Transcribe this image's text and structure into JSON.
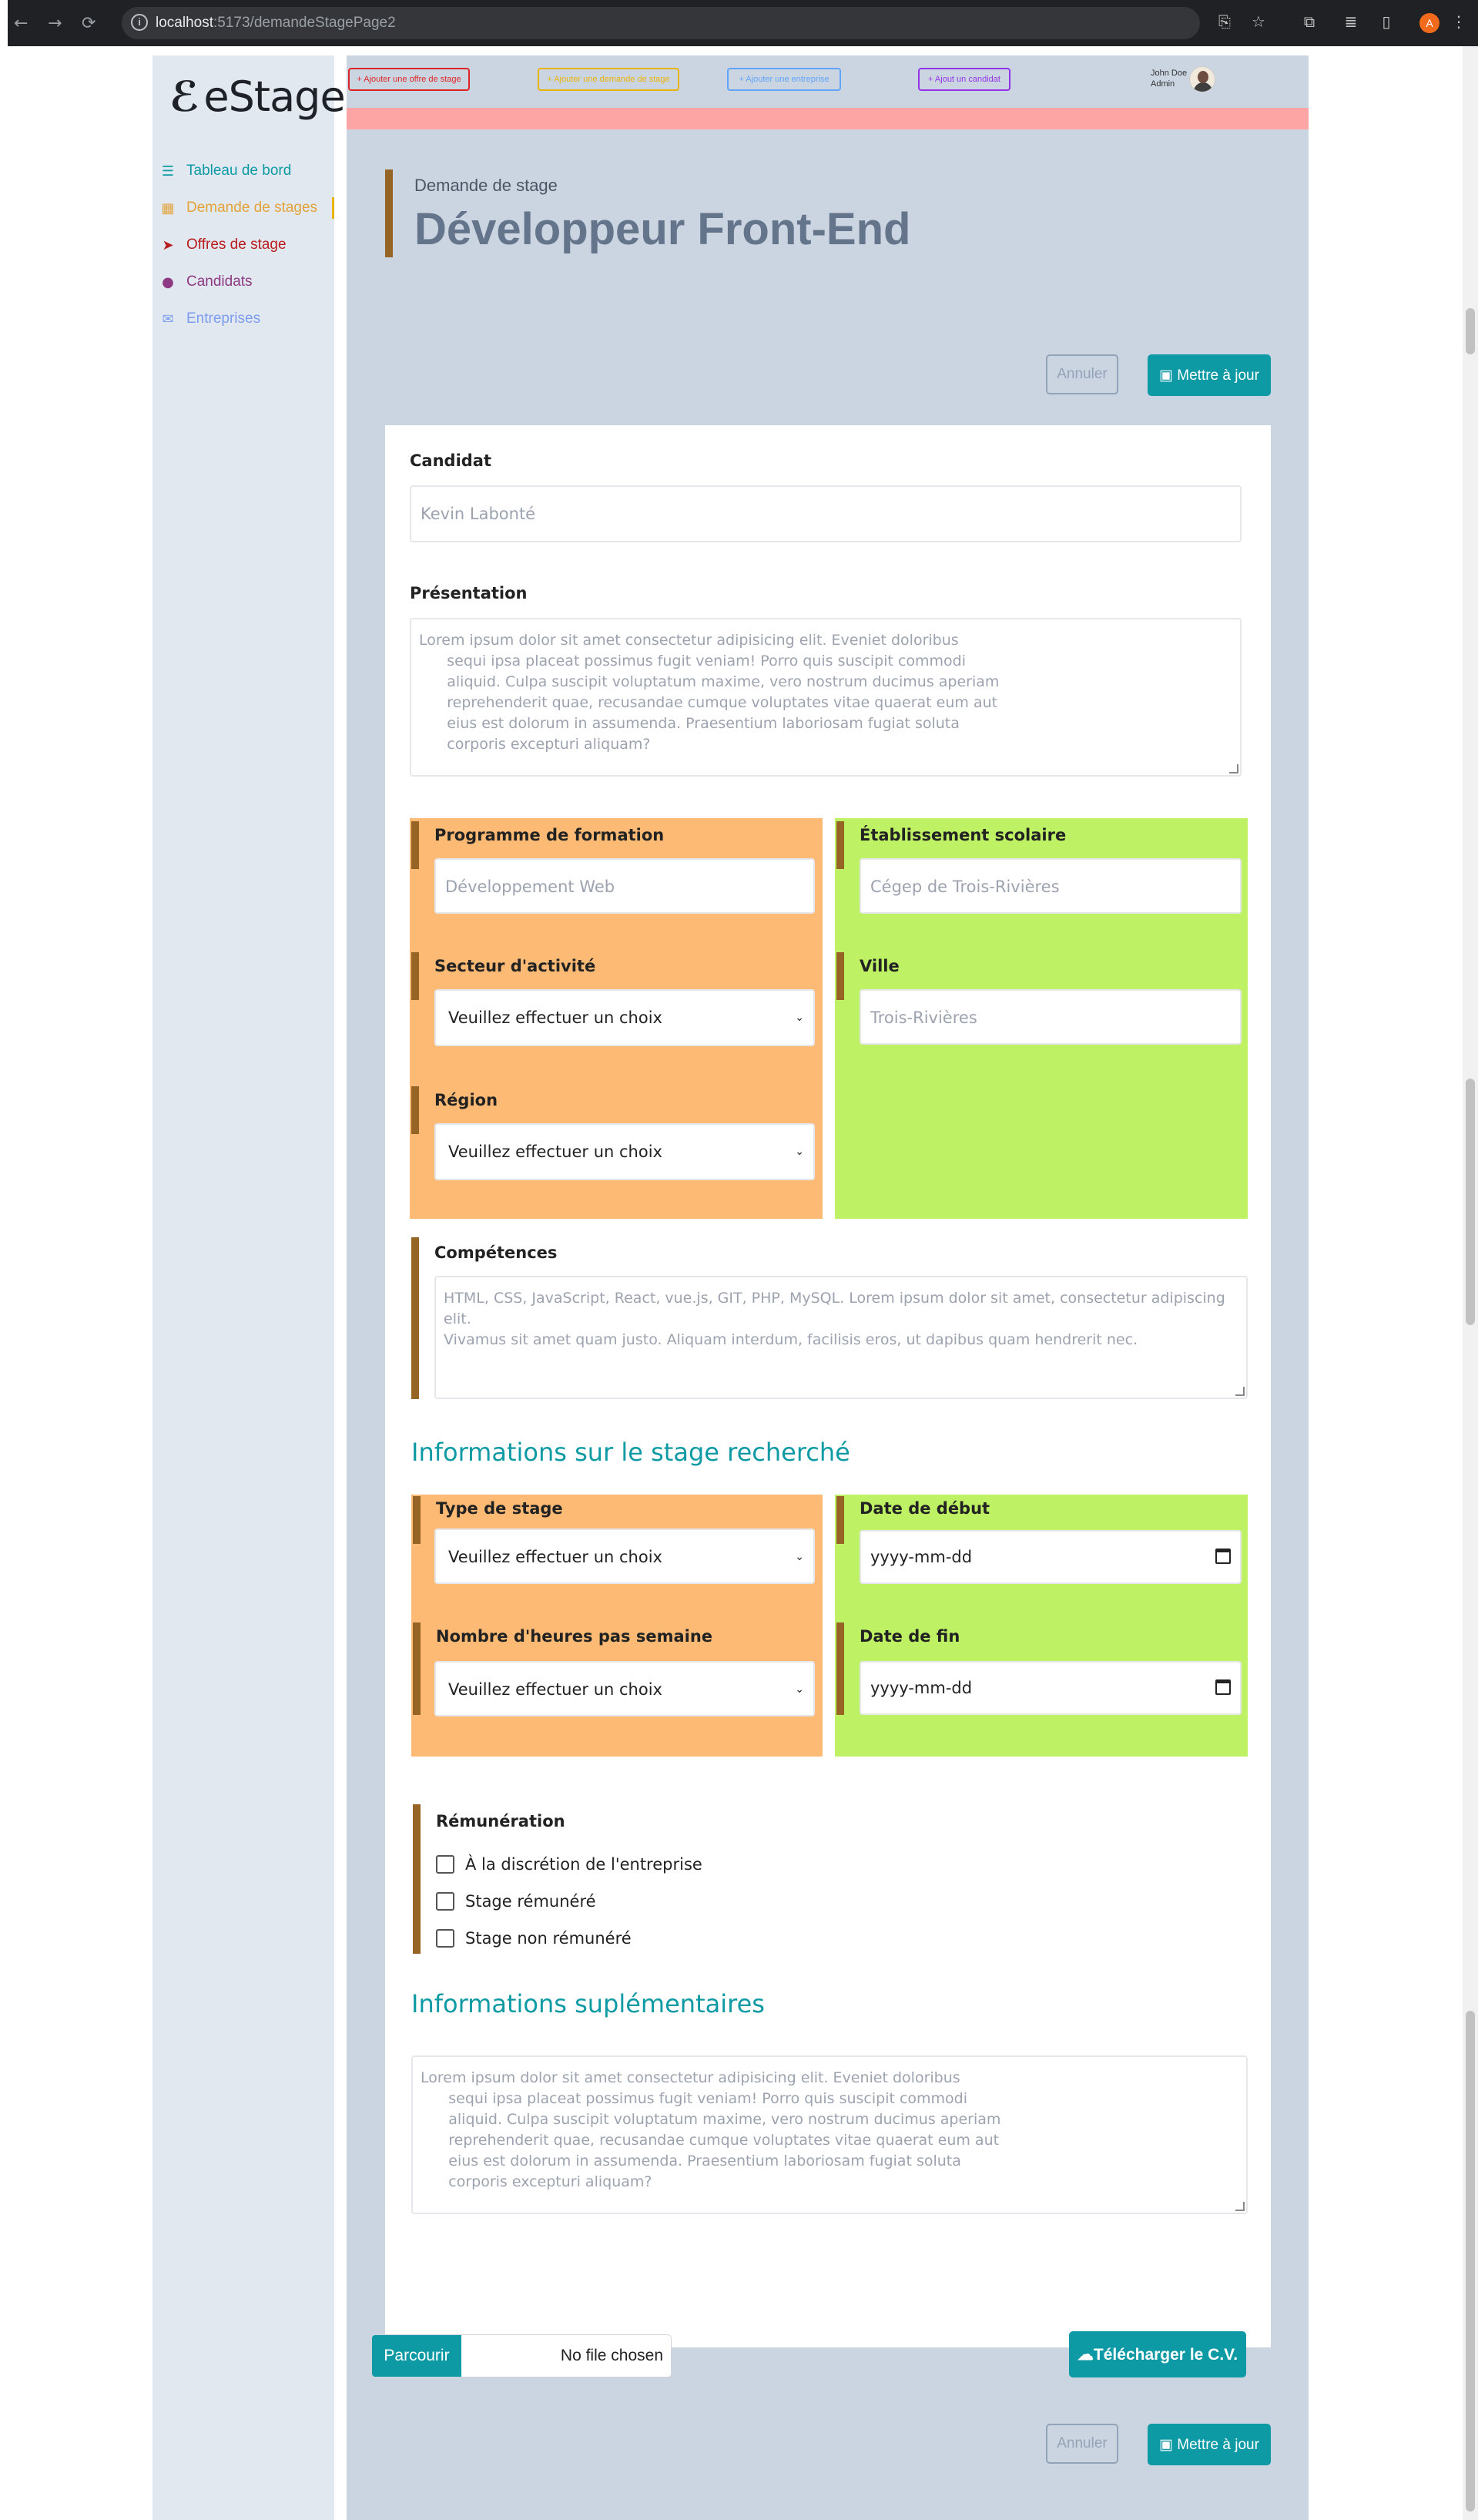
{
  "browser": {
    "url_host": "localhost",
    "url_rest": ":5173/demandeStagePage2",
    "profile_initial": "A"
  },
  "sidebar": {
    "logo": "eStage",
    "items": [
      {
        "label": "Tableau de bord",
        "icon": "list-icon",
        "color": "#0e9aa4"
      },
      {
        "label": "Demande de stages",
        "icon": "calendar-icon",
        "color": "#e3a33a"
      },
      {
        "label": "Offres de stage",
        "icon": "send-icon",
        "color": "#b91c1c"
      },
      {
        "label": "Candidats",
        "icon": "user-icon",
        "color": "#8e3a82"
      },
      {
        "label": "Entreprises",
        "icon": "mail-icon",
        "color": "#7b9cf0"
      }
    ]
  },
  "topbar": {
    "quick_actions": [
      {
        "label": "+ Ajouter une offre de stage",
        "color": "#dc2626"
      },
      {
        "label": "+ Ajouter une demande de stage",
        "color": "#eab308"
      },
      {
        "label": "+ Ajouter une entreprise",
        "color": "#60a5fa"
      },
      {
        "label": "+ Ajout un candidat",
        "color": "#9333ea"
      }
    ],
    "user_name": "John Doe",
    "user_role": "Admin"
  },
  "header": {
    "subtitle": "Demande de stage",
    "title": "Développeur Front-End"
  },
  "actions": {
    "cancel": "Annuler",
    "update": "Mettre à jour"
  },
  "form": {
    "candidat_label": "Candidat",
    "candidat_placeholder": "Kevin Labonté",
    "presentation_label": "Présentation",
    "presentation_text": "Lorem ipsum dolor sit amet consectetur adipisicing elit. Eveniet doloribus\n      sequi ipsa placeat possimus fugit veniam! Porro quis suscipit commodi\n      aliquid. Culpa suscipit voluptatum maxime, vero nostrum ducimus aperiam\n      reprehenderit quae, recusandae cumque voluptates vitae quaerat eum aut\n      eius est dolorum in assumenda. Praesentium laboriosam fugiat soluta\n      corporis excepturi aliquam?",
    "programme_label": "Programme de formation",
    "programme_placeholder": "Développement Web",
    "etablissement_label": "Établissement scolaire",
    "etablissement_placeholder": "Cégep de Trois-Rivières",
    "secteur_label": "Secteur d'activité",
    "secteur_value": "Veuillez effectuer un choix",
    "ville_label": "Ville",
    "ville_placeholder": "Trois-Rivières",
    "region_label": "Région",
    "region_value": "Veuillez effectuer un choix",
    "competences_label": "Compétences",
    "competences_text": "HTML, CSS, JavaScript, React, vue.js, GIT, PHP, MySQL. Lorem ipsum dolor sit amet, consectetur adipiscing elit.\nVivamus sit amet quam justo. Aliquam interdum, facilisis eros, ut dapibus quam hendrerit nec.",
    "stage_section_title": "Informations sur le stage recherché",
    "type_label": "Type de stage",
    "type_value": "Veuillez effectuer un choix",
    "date_debut_label": "Date de début",
    "date_debut_value": "yyyy-mm-dd",
    "heures_label": "Nombre d'heures pas semaine",
    "heures_value": "Veuillez effectuer un choix",
    "date_fin_label": "Date de fin",
    "date_fin_value": "yyyy-mm-dd",
    "remuneration_label": "Rémunération",
    "remuneration_options": [
      "À la discrétion de l'entreprise",
      "Stage rémunéré",
      "Stage non rémunéré"
    ],
    "supp_section_title": "Informations suplémentaires",
    "supp_text": "Lorem ipsum dolor sit amet consectetur adipisicing elit. Eveniet doloribus\n      sequi ipsa placeat possimus fugit veniam! Porro quis suscipit commodi\n      aliquid. Culpa suscipit voluptatum maxime, vero nostrum ducimus aperiam\n      reprehenderit quae, recusandae cumque voluptates vitae quaerat eum aut\n      eius est dolorum in assumenda. Praesentium laboriosam fugiat soluta\n      corporis excepturi aliquam?",
    "browse_label": "Parcourir",
    "no_file": "No file chosen",
    "download_cv": "Télécharger le C.V."
  }
}
